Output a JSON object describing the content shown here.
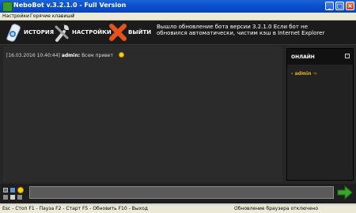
{
  "window": {
    "title": "NeboBot v.3.2.1.0 - Full Version",
    "minimize": "_",
    "maximize": "□",
    "close": "×"
  },
  "menu": [
    "Настройки",
    "Горячие клавиши",
    "?"
  ],
  "toolbar": {
    "history_label": "ИСТОРИЯ",
    "settings_label": "НАСТРОЙКИ",
    "exit_label": "ВЫЙТИ",
    "notice": "Вышло обновление бота версии 3.2.1.0 Если бот не обновился автоматически, чистим кэш в Internet Explorer"
  },
  "chat": {
    "messages": [
      {
        "timestamp": "[16.03.2016 10:40:44]",
        "user": "admin:",
        "text": "Всем привет",
        "emoji": "smiley"
      }
    ]
  },
  "online": {
    "title": "ОНЛАЙН",
    "collapse": "-",
    "users": [
      "- admin ¬"
    ]
  },
  "input": {
    "value": ""
  },
  "status": {
    "hotkeys": "Esc - Стоп   F1 - Пауза   F2 - Старт   F5 - Обновить   F10 - Выход",
    "browser": "Обновление браузера отключено"
  },
  "colors": {
    "titlebar": "#0a4fd0",
    "background": "#262626",
    "online_user": "#e6b21a",
    "send_arrow": "#3aa52a",
    "exit_icon": "#e2541b"
  },
  "icons": [
    "history-icon",
    "settings-icon",
    "exit-icon",
    "send-arrow-icon",
    "smiley-icon"
  ]
}
